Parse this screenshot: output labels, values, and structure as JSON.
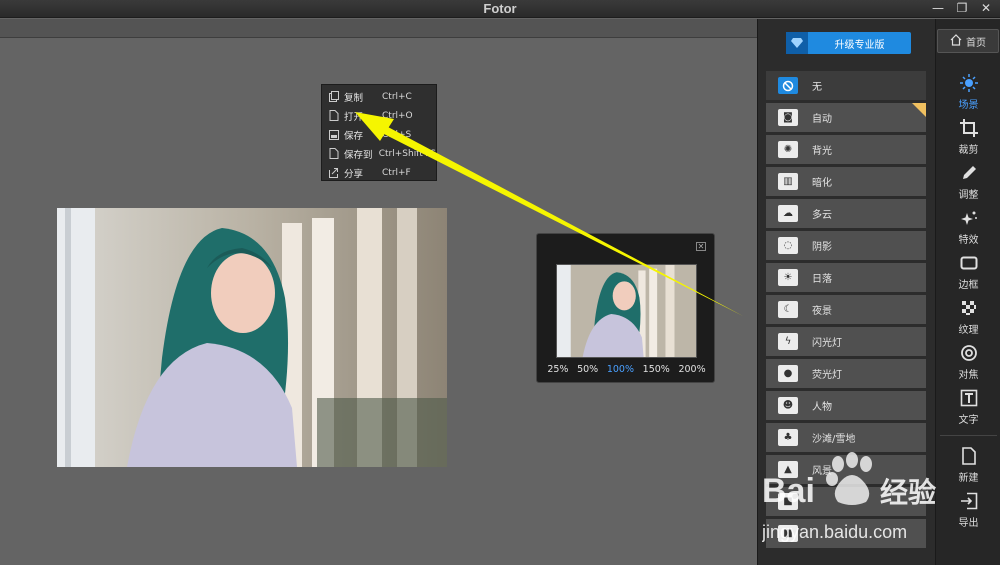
{
  "app": {
    "title": "Fotor"
  },
  "window": {
    "minimize": "—",
    "restore": "❐",
    "close": "✕"
  },
  "context_menu": {
    "items": [
      {
        "label": "复制",
        "shortcut": "Ctrl+C",
        "icon": "copy-icon"
      },
      {
        "label": "打开",
        "shortcut": "Ctrl+O",
        "icon": "file-icon"
      },
      {
        "label": "保存",
        "shortcut": "Ctrl+S",
        "icon": "save-icon"
      },
      {
        "label": "保存到",
        "shortcut": "Ctrl+Shift+S",
        "icon": "file-icon"
      },
      {
        "label": "分享",
        "shortcut": "Ctrl+F",
        "icon": "share-icon"
      }
    ]
  },
  "preview": {
    "close": "✕",
    "zoom_levels": [
      "25%",
      "50%",
      "100%",
      "150%",
      "200%"
    ],
    "active_zoom": "100%"
  },
  "upgrade_button": {
    "label": "升级专业版",
    "icon": "diamond-icon"
  },
  "home_button": {
    "label": "首页",
    "icon": "home-icon"
  },
  "scenes": {
    "items": [
      {
        "label": "无",
        "icon": "none-icon"
      },
      {
        "label": "自动",
        "icon": "camera-icon"
      },
      {
        "label": "背光",
        "icon": "backlight-icon"
      },
      {
        "label": "暗化",
        "icon": "darken-icon"
      },
      {
        "label": "多云",
        "icon": "cloud-icon"
      },
      {
        "label": "阴影",
        "icon": "shadow-icon"
      },
      {
        "label": "日落",
        "icon": "sunset-icon"
      },
      {
        "label": "夜景",
        "icon": "moon-icon"
      },
      {
        "label": "闪光灯",
        "icon": "flash-icon"
      },
      {
        "label": "荧光灯",
        "icon": "bulb-icon"
      },
      {
        "label": "人物",
        "icon": "person-icon"
      },
      {
        "label": "沙滩/雪地",
        "icon": "beach-icon"
      },
      {
        "label": "风景",
        "icon": "landscape-icon"
      },
      {
        "label": "",
        "icon": "extra-icon"
      },
      {
        "label": "",
        "icon": "extra-icon"
      }
    ]
  },
  "tools": {
    "items": [
      {
        "label": "场景",
        "icon": "scene-icon",
        "active": true
      },
      {
        "label": "裁剪",
        "icon": "crop-icon"
      },
      {
        "label": "调整",
        "icon": "pencil-icon"
      },
      {
        "label": "特效",
        "icon": "sparkle-icon"
      },
      {
        "label": "边框",
        "icon": "frame-icon"
      },
      {
        "label": "纹理",
        "icon": "texture-icon"
      },
      {
        "label": "对焦",
        "icon": "focus-icon"
      },
      {
        "label": "文字",
        "icon": "text-icon"
      }
    ],
    "bottom": [
      {
        "label": "新建",
        "icon": "new-file-icon"
      },
      {
        "label": "导出",
        "icon": "export-icon"
      }
    ]
  },
  "watermark": {
    "brand": "Bai",
    "brand2": "经验",
    "url": "jingyan.baidu.com"
  },
  "colors": {
    "accent": "#1f8ae0",
    "arrow": "#f5f500"
  }
}
